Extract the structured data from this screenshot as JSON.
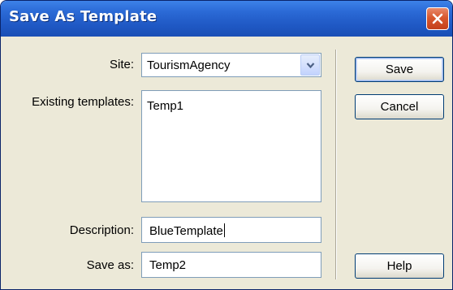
{
  "window": {
    "title": "Save As Template"
  },
  "form": {
    "site_label": "Site:",
    "site_value": "TourismAgency",
    "existing_label": "Existing templates:",
    "existing_templates": [
      "Temp1"
    ],
    "description_label": "Description:",
    "description_value": "BlueTemplate",
    "saveas_label": "Save as:",
    "saveas_value": "Temp2"
  },
  "buttons": {
    "save": "Save",
    "cancel": "Cancel",
    "help": "Help"
  },
  "colors": {
    "titlebar": "#2b6ad6",
    "close": "#d8582f",
    "dialog_bg": "#ece9d8",
    "field_border": "#7f9db9"
  },
  "icons": {
    "close": "close-icon",
    "dropdown": "chevron-down-icon"
  }
}
